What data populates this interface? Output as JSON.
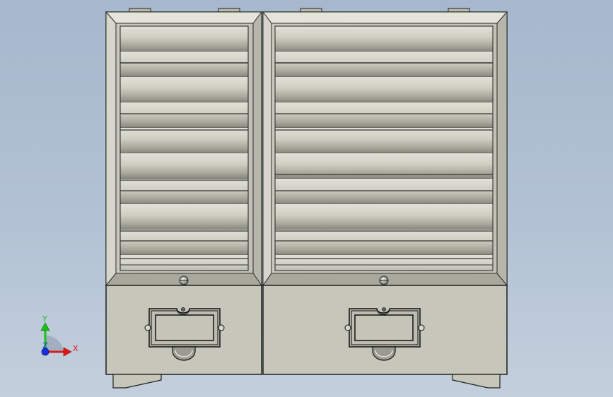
{
  "viewport": {
    "background_top": "#a6b8cc",
    "background_bottom": "#c3cfdc"
  },
  "model": {
    "body_color": "#c8c8bc",
    "louver_light": "#d6d6ca",
    "louver_dark": "#8e8e84",
    "outline_color": "#1e1e1e"
  },
  "triad": {
    "x_label": "X",
    "y_label": "Y",
    "z_label": "Z",
    "x_color": "#e01818",
    "y_color": "#18c018",
    "z_color": "#1830e0"
  }
}
